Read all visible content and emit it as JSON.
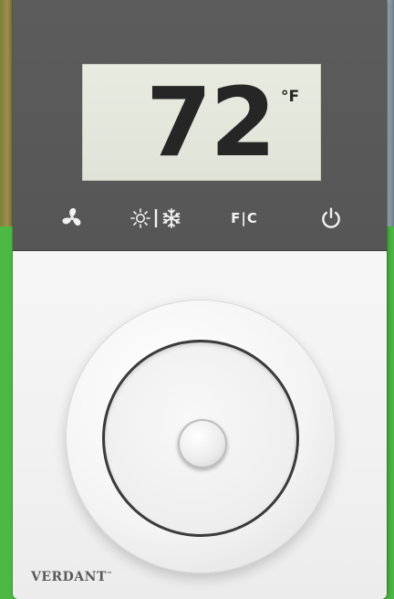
{
  "display": {
    "temperature": "72",
    "unit": "°F"
  },
  "controls": {
    "fan_icon": "fan-icon",
    "mode_icon": "sun-snowflake-icon",
    "unit_toggle_label": "F|C",
    "power_icon": "power-icon"
  },
  "brand": {
    "name": "VERDANT",
    "trademark": "™"
  },
  "colors": {
    "background": "#4cb944",
    "top_panel": "#5a5a5a",
    "lcd": "#e3e7dc",
    "lcd_digits": "#262626",
    "icon": "#f3f3f3",
    "body": "#f3f3f3"
  }
}
